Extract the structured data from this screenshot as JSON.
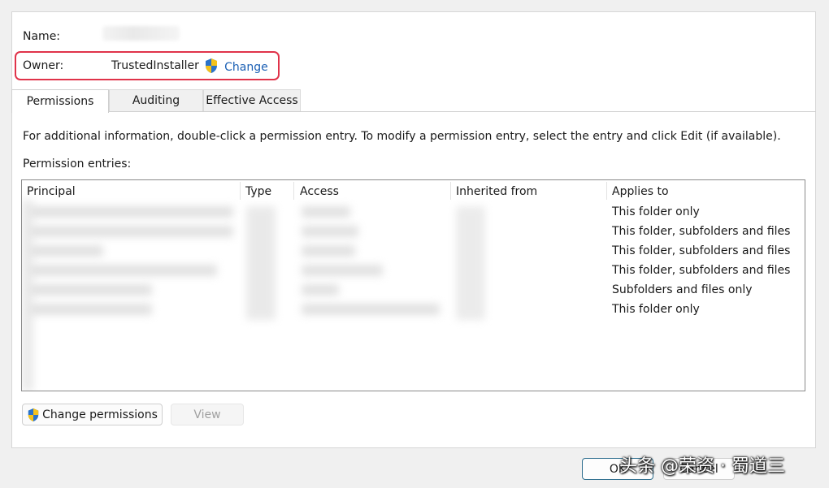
{
  "header": {
    "name_label": "Name:",
    "owner_label": "Owner:",
    "owner_value": "TrustedInstaller",
    "change_link": "Change"
  },
  "tabs": [
    {
      "label": "Permissions",
      "active": true
    },
    {
      "label": "Auditing",
      "active": false
    },
    {
      "label": "Effective Access",
      "active": false
    }
  ],
  "info_text": "For additional information, double-click a permission entry. To modify a permission entry, select the entry and click Edit (if available).",
  "entries_label": "Permission entries:",
  "table": {
    "columns": [
      "Principal",
      "Type",
      "Access",
      "Inherited from",
      "Applies to"
    ],
    "applies_to": [
      "This folder only",
      "This folder, subfolders and files",
      "This folder, subfolders and files",
      "This folder, subfolders and files",
      "Subfolders and files only",
      "This folder only"
    ]
  },
  "buttons": {
    "change_permissions": "Change permissions",
    "view": "View",
    "ok": "OK",
    "cancel": "Cancel"
  },
  "watermark": "头条 @荣资 · 蜀道三",
  "colors": {
    "highlight_border": "#e0334a",
    "link": "#1a5fb4"
  },
  "icons": [
    "uac-shield-icon"
  ]
}
